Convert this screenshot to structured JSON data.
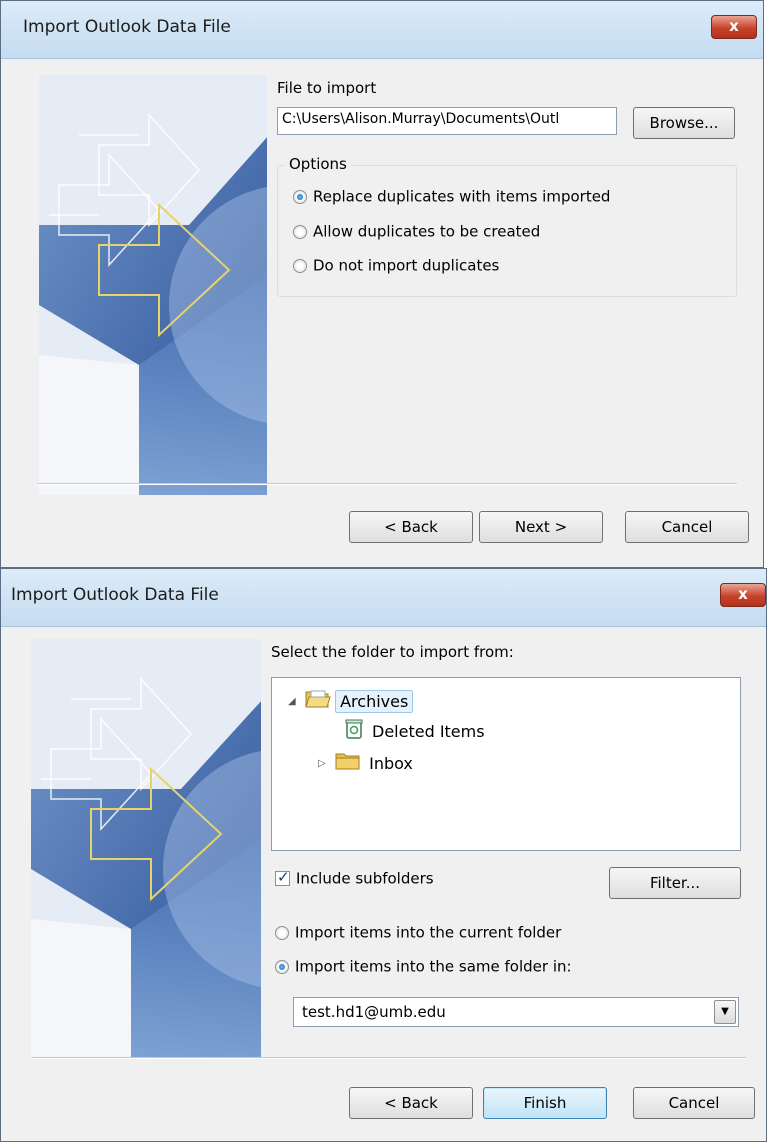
{
  "dialog1": {
    "title": "Import Outlook Data File",
    "close_glyph": "x",
    "file_label": "File to import",
    "file_path": "C:\\Users\\Alison.Murray\\Documents\\Outl",
    "browse_label": "Browse...",
    "options_label": "Options",
    "options": [
      {
        "label": "Replace duplicates with items imported",
        "checked": true
      },
      {
        "label": "Allow duplicates to be created",
        "checked": false
      },
      {
        "label": "Do not import duplicates",
        "checked": false
      }
    ],
    "back_label": "< Back",
    "next_label": "Next >",
    "cancel_label": "Cancel"
  },
  "dialog2": {
    "title": "Import Outlook Data File",
    "close_glyph": "x",
    "select_label": "Select the folder to import from:",
    "tree": [
      {
        "label": "Archives",
        "expanded": true,
        "icon": "folder-open-icon",
        "selected": true
      },
      {
        "label": "Deleted Items",
        "icon": "recycle-bin-icon"
      },
      {
        "label": "Inbox",
        "icon": "folder-icon",
        "collapsed": true
      }
    ],
    "include_subfolders_label": "Include subfolders",
    "include_subfolders_checked": true,
    "filter_label": "Filter...",
    "import_current_label": "Import items into the current folder",
    "import_same_label": "Import items into the same folder in:",
    "import_same_checked": true,
    "destination": "test.hd1@umb.edu",
    "back_label": "< Back",
    "finish_label": "Finish",
    "cancel_label": "Cancel"
  },
  "colors": {
    "titlebar": "#c5dcf1",
    "close": "#c7432c",
    "accent": "#3c7fb1"
  }
}
